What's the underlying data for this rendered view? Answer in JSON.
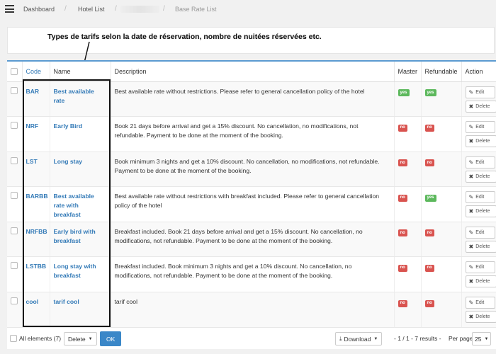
{
  "nav": {
    "breadcrumb": [
      "Dashboard",
      "Hotel List",
      "Base Rate List"
    ]
  },
  "annotation": {
    "text": "Types de tarifs selon la date de réservation, nombre de nuitées réservées etc."
  },
  "table": {
    "headers": {
      "code": "Code",
      "name": "Name",
      "description": "Description",
      "master": "Master",
      "refundable": "Refundable",
      "action": "Action"
    },
    "action_labels": {
      "edit": "Edit",
      "delete": "Delete"
    },
    "rows": [
      {
        "code": "BAR",
        "name": "Best available rate",
        "description": "Best available rate without restrictions. Please refer to general cancellation policy of the hotel",
        "master": "yes",
        "refundable": "yes"
      },
      {
        "code": "NRF",
        "name": "Early Bird",
        "description": "Book 21 days before arrival and get a 15% discount. No cancellation, no modifications, not refundable. Payment to be done at the moment of the booking.",
        "master": "no",
        "refundable": "no"
      },
      {
        "code": "LST",
        "name": "Long stay",
        "description": "Book minimum 3 nights and get a 10% discount. No cancellation, no modifications, not refundable. Payment to be done at the moment of the booking.",
        "master": "no",
        "refundable": "no"
      },
      {
        "code": "BARBB",
        "name": "Best available rate with breakfast",
        "description": "Best available rate without restrictions with breakfast included. Please refer to general cancellation policy of the hotel",
        "master": "no",
        "refundable": "yes"
      },
      {
        "code": "NRFBB",
        "name": "Early bird with breakfast",
        "description": "Breakfast included. Book 21 days before arrival and get a 15% discount. No cancellation, no modifications, not refundable. Payment to be done at the moment of the booking.",
        "master": "no",
        "refundable": "no"
      },
      {
        "code": "LSTBB",
        "name": "Long stay with breakfast",
        "description": "Breakfast included. Book minimum 3 nights and get a 10% discount. No cancellation, no modifications, not refundable. Payment to be done at the moment of the booking.",
        "master": "no",
        "refundable": "no"
      },
      {
        "code": "cool",
        "name": "tarif cool",
        "description": "tarif cool",
        "master": "no",
        "refundable": "no"
      }
    ]
  },
  "footer": {
    "all_elements": "All elements (7)",
    "bulk_action": "Delete",
    "ok": "OK",
    "download": "Download",
    "pagination": "- 1 / 1 - 7 results -",
    "per_page_label": "Per page",
    "per_page_value": "25"
  },
  "colors": {
    "accent": "#337ab7",
    "yes": "#5cb85c",
    "no": "#d9534f",
    "primary": "#3a87c8"
  }
}
